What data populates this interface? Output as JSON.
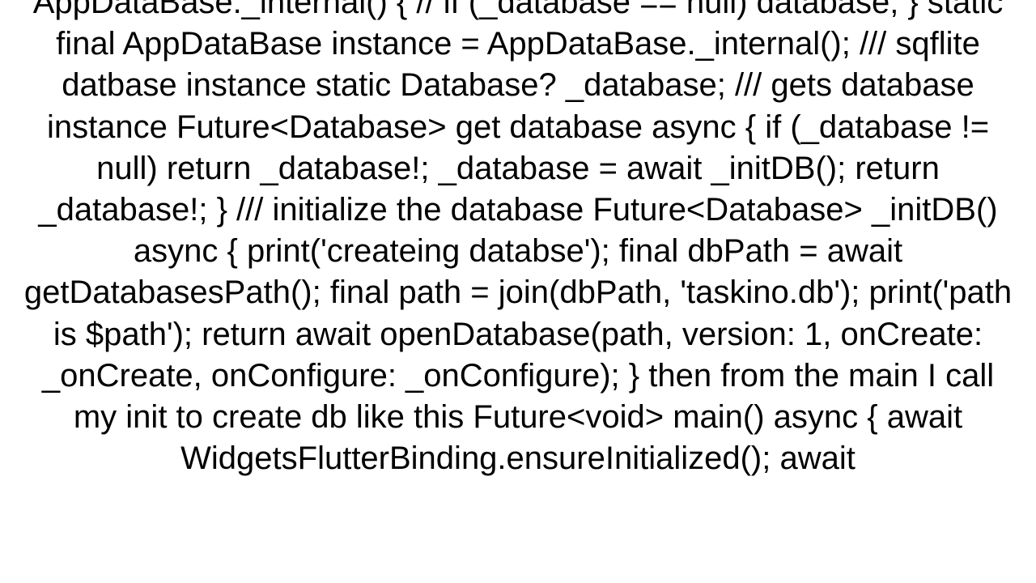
{
  "code_text": "AppDataBase._internal() {     // if (_database == null) database;   }   static final AppDataBase instance = AppDataBase._internal();    /// sqflite datbase instance   static Database? _database;    /// gets database instance   Future<Database> get database async {     if (_database != null) return _database!;      _database = await _initDB();     return _database!;   }    /// initialize the database   Future<Database> _initDB() async {     print('createing databse');     final dbPath = await getDatabasesPath();     final path = join(dbPath, 'taskino.db');      print('path is $path');      return await openDatabase(path, version: 1, onCreate: _onCreate, onConfigure: _onConfigure);   }   then from the main I call my init to create db  like this Future<void> main() async {   await WidgetsFlutterBinding.ensureInitialized();   await"
}
